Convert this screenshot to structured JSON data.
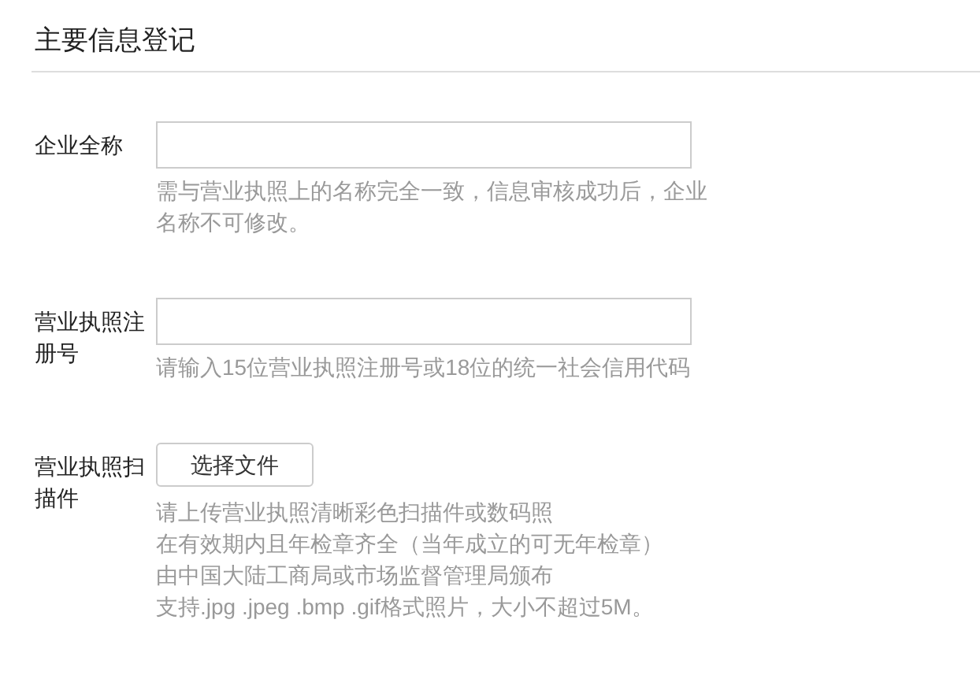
{
  "title": "主要信息登记",
  "fields": [
    {
      "kind": "input",
      "label": "企业全称",
      "hints": [
        "需与营业执照上的名称完全一致，信息审核成功后，企业名称不可修改。"
      ]
    },
    {
      "kind": "input",
      "label": "营业执照注册号",
      "hints": [
        "请输入15位营业执照注册号或18位的统一社会信用代码"
      ]
    },
    {
      "kind": "file",
      "label": "营业执照扫描件",
      "button": "选择文件",
      "hints": [
        "请上传营业执照清晰彩色扫描件或数码照",
        "在有效期内且年检章齐全（当年成立的可无年检章）",
        "由中国大陆工商局或市场监督管理局颁布",
        "支持.jpg .jpeg .bmp .gif格式照片，大小不超过5M。"
      ]
    }
  ]
}
